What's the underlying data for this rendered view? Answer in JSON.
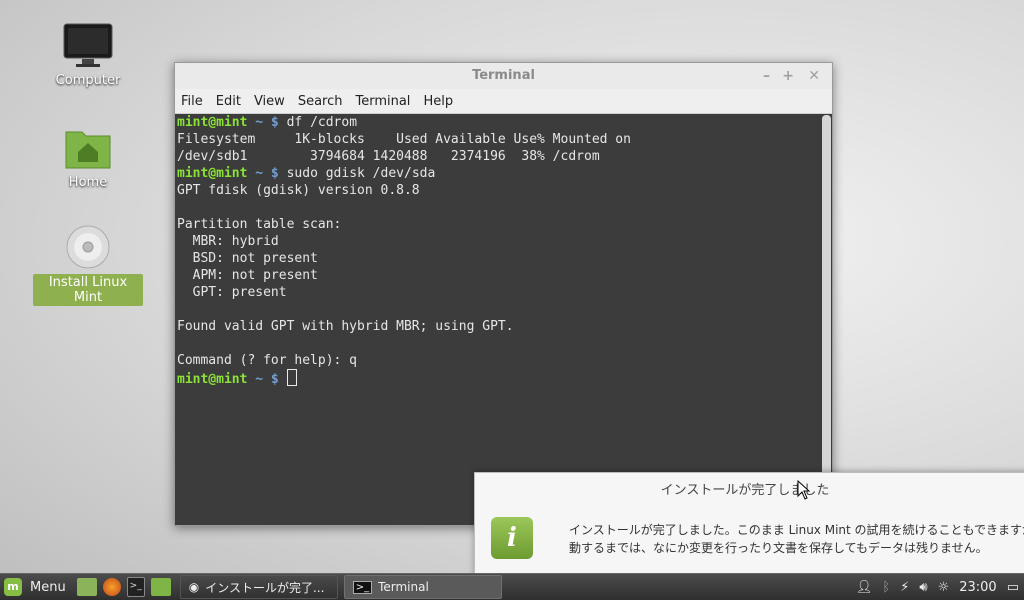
{
  "desktop": {
    "icons": [
      {
        "label": "Computer"
      },
      {
        "label": "Home"
      },
      {
        "label": "Install Linux Mint"
      }
    ]
  },
  "terminal": {
    "title": "Terminal",
    "menu": [
      "File",
      "Edit",
      "View",
      "Search",
      "Terminal",
      "Help"
    ],
    "prompt_user": "mint@mint",
    "prompt_path": "~ $",
    "lines": [
      {
        "type": "cmd",
        "text": "df /cdrom"
      },
      {
        "type": "out",
        "text": "Filesystem     1K-blocks    Used Available Use% Mounted on"
      },
      {
        "type": "out",
        "text": "/dev/sdb1        3794684 1420488   2374196  38% /cdrom"
      },
      {
        "type": "cmd",
        "text": "sudo gdisk /dev/sda"
      },
      {
        "type": "out",
        "text": "GPT fdisk (gdisk) version 0.8.8"
      },
      {
        "type": "out",
        "text": ""
      },
      {
        "type": "out",
        "text": "Partition table scan:"
      },
      {
        "type": "out",
        "text": "  MBR: hybrid"
      },
      {
        "type": "out",
        "text": "  BSD: not present"
      },
      {
        "type": "out",
        "text": "  APM: not present"
      },
      {
        "type": "out",
        "text": "  GPT: present"
      },
      {
        "type": "out",
        "text": ""
      },
      {
        "type": "out",
        "text": "Found valid GPT with hybrid MBR; using GPT."
      },
      {
        "type": "out",
        "text": ""
      },
      {
        "type": "out",
        "text": "Command (? for help): q"
      },
      {
        "type": "cmd",
        "text": ""
      }
    ]
  },
  "notification": {
    "title": "インストールが完了しました",
    "line1": "インストールが完了しました。このまま Linux Mint の試用を続けることもできますが、コンピュ",
    "line2": "動するまでは、なにか変更を行ったり文書を保存してもデータは残りません。"
  },
  "panel": {
    "menu_label": "Menu",
    "tasks": [
      {
        "label": "インストールが完了..."
      },
      {
        "label": "Terminal"
      }
    ],
    "clock": "23:00"
  },
  "colors": {
    "accent": "#86be43",
    "prompt": "#8ae234",
    "path": "#729fcf",
    "terminal_bg": "#3c3c3c"
  }
}
